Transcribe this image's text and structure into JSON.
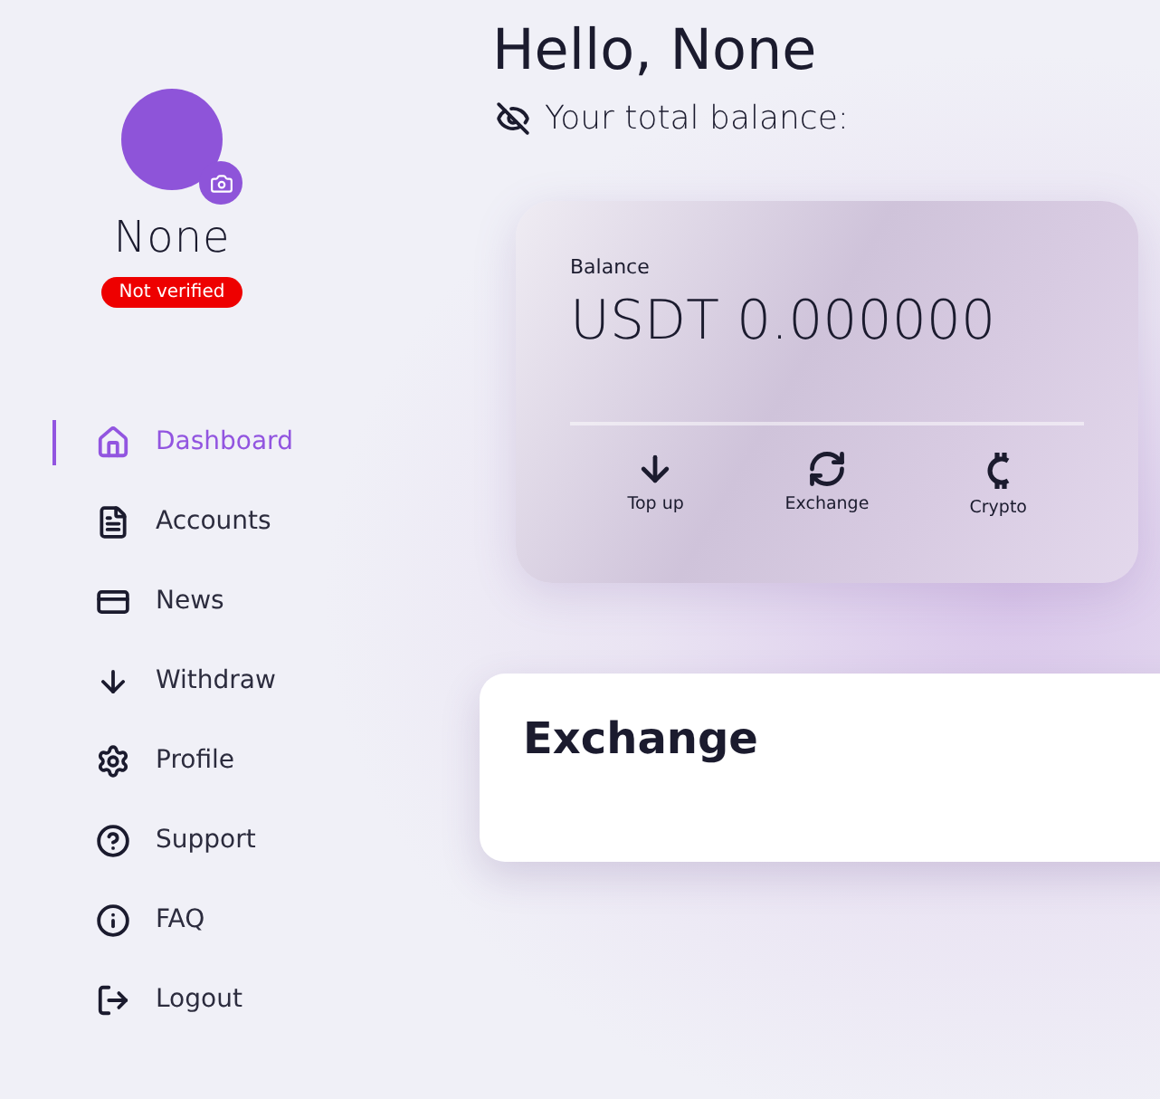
{
  "profile": {
    "name": "None",
    "status": "Not verified",
    "verified": false
  },
  "nav": [
    {
      "label": "Dashboard",
      "selected": true
    },
    {
      "label": "Accounts",
      "selected": false
    },
    {
      "label": "News",
      "selected": false
    },
    {
      "label": "Withdraw",
      "selected": false
    },
    {
      "label": "Profile",
      "selected": false
    },
    {
      "label": "Support",
      "selected": false
    },
    {
      "label": "FAQ",
      "selected": false
    },
    {
      "label": "Logout",
      "selected": false
    }
  ],
  "greeting": "Hello, None",
  "balance_caption": "Your total balance:",
  "balance_card": {
    "label": "Balance",
    "amount": "USDT 0.000000",
    "actions": [
      "Top up",
      "Exchange",
      "Crypto"
    ]
  },
  "exchange_card": {
    "title": "Exchange"
  }
}
